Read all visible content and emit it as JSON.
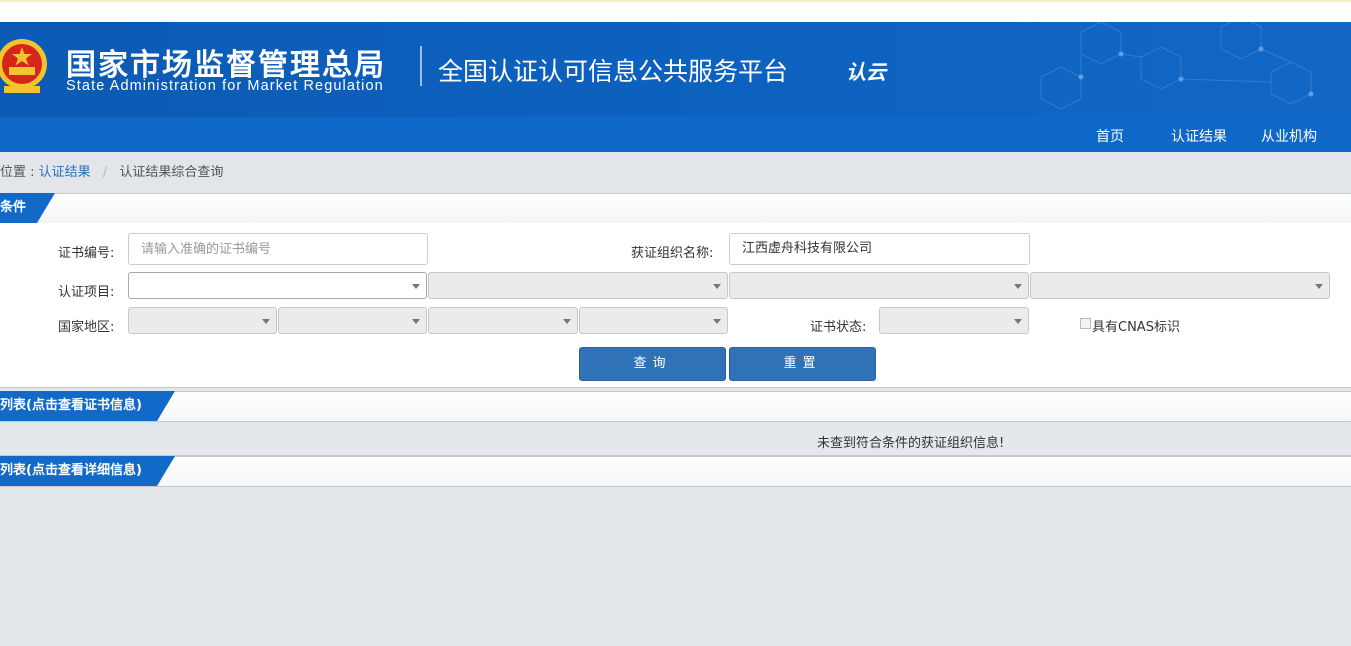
{
  "header": {
    "agency_cn": "国家市场监督管理总局",
    "agency_en": "State Administration  for  Market Regulation",
    "platform": "全国认证认可信息公共服务平台",
    "logo_text": "认云",
    "brand_color": "#0f68c7"
  },
  "nav": {
    "items": [
      {
        "label": "首页"
      },
      {
        "label": "认证结果"
      },
      {
        "label": "从业机构"
      }
    ]
  },
  "breadcrumb": {
    "prefix": "位置 :",
    "link": "认证结果",
    "separator": "/",
    "current": "认证结果综合查询"
  },
  "conditions": {
    "section_title": "条件",
    "cert_no_label": "证书编号:",
    "cert_no_placeholder": "请输入准确的证书编号",
    "org_name_label": "获证组织名称:",
    "org_name_value": "江西虚舟科技有限公司",
    "project_label": "认证项目:",
    "region_label": "国家地区:",
    "status_label": "证书状态:",
    "cnas_label": "具有CNAS标识",
    "search_button": "查询",
    "reset_button": "重置"
  },
  "cert_list": {
    "section_title": "列表(点击查看证书信息)",
    "empty_message": "未查到符合条件的获证组织信息!"
  },
  "detail_list": {
    "section_title": "列表(点击查看详细信息)"
  }
}
